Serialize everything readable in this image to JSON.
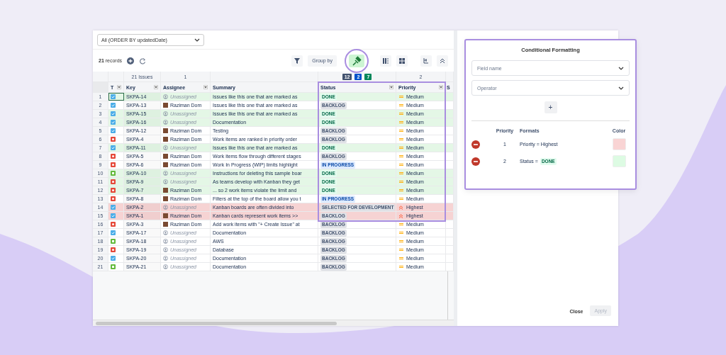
{
  "view_select": {
    "value": "All (ORDER BY updatedDate)"
  },
  "toolbar": {
    "records_count": "21",
    "records_label": "records",
    "group_by": "Group by"
  },
  "group_header": {
    "key": "21 Issues",
    "assignee": "1",
    "status_badges": [
      {
        "text": "12",
        "color": "#42526e"
      },
      {
        "text": "2",
        "color": "#0052cc"
      },
      {
        "text": "7",
        "color": "#00875a"
      }
    ],
    "priority": "2"
  },
  "columns": [
    {
      "label": "T",
      "menu": true
    },
    {
      "label": "Key",
      "menu": true
    },
    {
      "label": "Assignee",
      "menu": true
    },
    {
      "label": "Summary",
      "menu": false
    },
    {
      "label": "Status",
      "menu": true
    },
    {
      "label": "Priority",
      "menu": true
    },
    {
      "label": "S",
      "menu": false
    }
  ],
  "rows": [
    {
      "number": "1",
      "kind": "task",
      "key": "SKPA-14",
      "assignee": {
        "kind": "unassigned",
        "name": "Unassigned"
      },
      "summary": "Issues like this one that are marked as",
      "status": {
        "text": "DONE",
        "kind": "done"
      },
      "priority": {
        "text": "Medium",
        "kind": "medium"
      },
      "color": "#e4f7e6",
      "selected": true
    },
    {
      "number": "2",
      "kind": "task",
      "key": "SKPA-13",
      "assignee": {
        "kind": "user",
        "name": "Raziman Dom"
      },
      "summary": "Issues like this one that are marked as",
      "status": {
        "text": "BACKLOG",
        "kind": "todo"
      },
      "priority": {
        "text": "Medium",
        "kind": "medium"
      },
      "selected": false
    },
    {
      "number": "3",
      "kind": "task",
      "key": "SKPA-15",
      "assignee": {
        "kind": "unassigned",
        "name": "Unassigned"
      },
      "summary": "Issues like this one that are marked as",
      "status": {
        "text": "DONE",
        "kind": "done"
      },
      "priority": {
        "text": "Medium",
        "kind": "medium"
      },
      "color": "#e4f7e6",
      "selected": false
    },
    {
      "number": "4",
      "kind": "task",
      "key": "SKPA-16",
      "assignee": {
        "kind": "unassigned",
        "name": "Unassigned"
      },
      "summary": "Documentation",
      "status": {
        "text": "DONE",
        "kind": "done"
      },
      "priority": {
        "text": "Medium",
        "kind": "medium"
      },
      "color": "#e4f7e6",
      "selected": false
    },
    {
      "number": "5",
      "kind": "task",
      "key": "SKPA-12",
      "assignee": {
        "kind": "user",
        "name": "Raziman Dom"
      },
      "summary": "Testing",
      "status": {
        "text": "BACKLOG",
        "kind": "todo"
      },
      "priority": {
        "text": "Medium",
        "kind": "medium"
      },
      "selected": false
    },
    {
      "number": "6",
      "kind": "bug",
      "key": "SKPA-4",
      "assignee": {
        "kind": "user",
        "name": "Raziman Dom"
      },
      "summary": "Work items are ranked in priority order",
      "status": {
        "text": "BACKLOG",
        "kind": "todo"
      },
      "priority": {
        "text": "Medium",
        "kind": "medium"
      },
      "selected": false
    },
    {
      "number": "7",
      "kind": "task",
      "key": "SKPA-11",
      "assignee": {
        "kind": "unassigned",
        "name": "Unassigned"
      },
      "summary": "Issues like this one that are marked as",
      "status": {
        "text": "DONE",
        "kind": "done"
      },
      "priority": {
        "text": "Medium",
        "kind": "medium"
      },
      "color": "#e4f7e6",
      "selected": false
    },
    {
      "number": "8",
      "kind": "bug",
      "key": "SKPA-5",
      "assignee": {
        "kind": "user",
        "name": "Raziman Dom"
      },
      "summary": "Work items flow through different stages",
      "status": {
        "text": "BACKLOG",
        "kind": "todo"
      },
      "priority": {
        "text": "Medium",
        "kind": "medium"
      },
      "selected": false
    },
    {
      "number": "9",
      "kind": "bug",
      "key": "SKPA-6",
      "assignee": {
        "kind": "user",
        "name": "Raziman Dom"
      },
      "summary": "Work In Progress (WIP) limits highlight",
      "status": {
        "text": "IN PROGRESS",
        "kind": "inprogress"
      },
      "priority": {
        "text": "Medium",
        "kind": "medium"
      },
      "selected": false
    },
    {
      "number": "10",
      "kind": "story",
      "key": "SKPA-10",
      "assignee": {
        "kind": "unassigned",
        "name": "Unassigned"
      },
      "summary": "Instructions for deleting this sample boar",
      "status": {
        "text": "DONE",
        "kind": "done"
      },
      "priority": {
        "text": "Medium",
        "kind": "medium"
      },
      "color": "#e4f7e6",
      "selected": false
    },
    {
      "number": "11",
      "kind": "bug",
      "key": "SKPA-9",
      "assignee": {
        "kind": "unassigned",
        "name": "Unassigned"
      },
      "summary": "As teams develop with Kanban they get",
      "status": {
        "text": "DONE",
        "kind": "done"
      },
      "priority": {
        "text": "Medium",
        "kind": "medium"
      },
      "color": "#e4f7e6",
      "selected": false
    },
    {
      "number": "12",
      "kind": "bug",
      "key": "SKPA-7",
      "assignee": {
        "kind": "user",
        "name": "Raziman Dom"
      },
      "summary": "... so 2 work items violate the limit and",
      "status": {
        "text": "DONE",
        "kind": "done"
      },
      "priority": {
        "text": "Medium",
        "kind": "medium"
      },
      "color": "#e4f7e6",
      "selected": false
    },
    {
      "number": "13",
      "kind": "bug",
      "key": "SKPA-8",
      "assignee": {
        "kind": "user",
        "name": "Raziman Dom"
      },
      "summary": "Filters at the top of the board allow you t",
      "status": {
        "text": "IN PROGRESS",
        "kind": "inprogress"
      },
      "priority": {
        "text": "Medium",
        "kind": "medium"
      },
      "selected": false
    },
    {
      "number": "14",
      "kind": "task",
      "key": "SKPA-2",
      "assignee": {
        "kind": "unassigned",
        "name": "Unassigned"
      },
      "summary": "Kanban boards are often divided into",
      "status": {
        "text": "SELECTED FOR DEVELOPMENT",
        "kind": "todo"
      },
      "priority": {
        "text": "Highest",
        "kind": "highest"
      },
      "color": "#f6d3d3",
      "selected": false
    },
    {
      "number": "15",
      "kind": "task",
      "key": "SKPA-1",
      "assignee": {
        "kind": "user",
        "name": "Raziman Dom"
      },
      "summary": "Kanban cards represent work items >>",
      "status": {
        "text": "BACKLOG",
        "kind": "todo"
      },
      "priority": {
        "text": "Highest",
        "kind": "highest"
      },
      "color": "#f6d3d3",
      "selected": false
    },
    {
      "number": "16",
      "kind": "bug",
      "key": "SKPA-3",
      "assignee": {
        "kind": "user",
        "name": "Raziman Dom"
      },
      "summary": "Add work items with \"+ Create Issue\" at",
      "status": {
        "text": "BACKLOG",
        "kind": "todo"
      },
      "priority": {
        "text": "Medium",
        "kind": "medium"
      },
      "selected": false
    },
    {
      "number": "17",
      "kind": "task",
      "key": "SKPA-17",
      "assignee": {
        "kind": "unassigned",
        "name": "Unassigned"
      },
      "summary": "Documentation",
      "status": {
        "text": "BACKLOG",
        "kind": "todo"
      },
      "priority": {
        "text": "Medium",
        "kind": "medium"
      },
      "selected": false
    },
    {
      "number": "18",
      "kind": "story",
      "key": "SKPA-18",
      "assignee": {
        "kind": "unassigned",
        "name": "Unassigned"
      },
      "summary": "AWS",
      "status": {
        "text": "BACKLOG",
        "kind": "todo"
      },
      "priority": {
        "text": "Medium",
        "kind": "medium"
      },
      "selected": false
    },
    {
      "number": "19",
      "kind": "bug",
      "key": "SKPA-19",
      "assignee": {
        "kind": "unassigned",
        "name": "Unassigned"
      },
      "summary": "Database",
      "status": {
        "text": "BACKLOG",
        "kind": "todo"
      },
      "priority": {
        "text": "Medium",
        "kind": "medium"
      },
      "selected": false
    },
    {
      "number": "20",
      "kind": "task",
      "key": "SKPA-20",
      "assignee": {
        "kind": "unassigned",
        "name": "Unassigned"
      },
      "summary": "Documentation",
      "status": {
        "text": "BACKLOG",
        "kind": "todo"
      },
      "priority": {
        "text": "Medium",
        "kind": "medium"
      },
      "selected": false
    },
    {
      "number": "21",
      "kind": "story",
      "key": "SKPA-21",
      "assignee": {
        "kind": "unassigned",
        "name": "Unassigned"
      },
      "summary": "Documentation",
      "status": {
        "text": "BACKLOG",
        "kind": "todo"
      },
      "priority": {
        "text": "Medium",
        "kind": "medium"
      },
      "selected": false
    }
  ],
  "format_panel": {
    "title": "Conditional Formatting",
    "field_select": {
      "placeholder": "Field name"
    },
    "operator_select": {
      "placeholder": "Operator"
    },
    "add_button": "+",
    "headers": [
      "Priority",
      "Formats",
      "Color"
    ],
    "rules": [
      {
        "priority": "1",
        "format": "Priority = Highest",
        "color": "#f9d4d4"
      },
      {
        "priority": "2",
        "format": "Status =",
        "badge": {
          "text": "DONE",
          "kind": "done"
        },
        "color": "#ddfbe3"
      }
    ]
  },
  "footer": {
    "close": "Close",
    "apply": {
      "label": "Apply",
      "disabled": true
    }
  }
}
